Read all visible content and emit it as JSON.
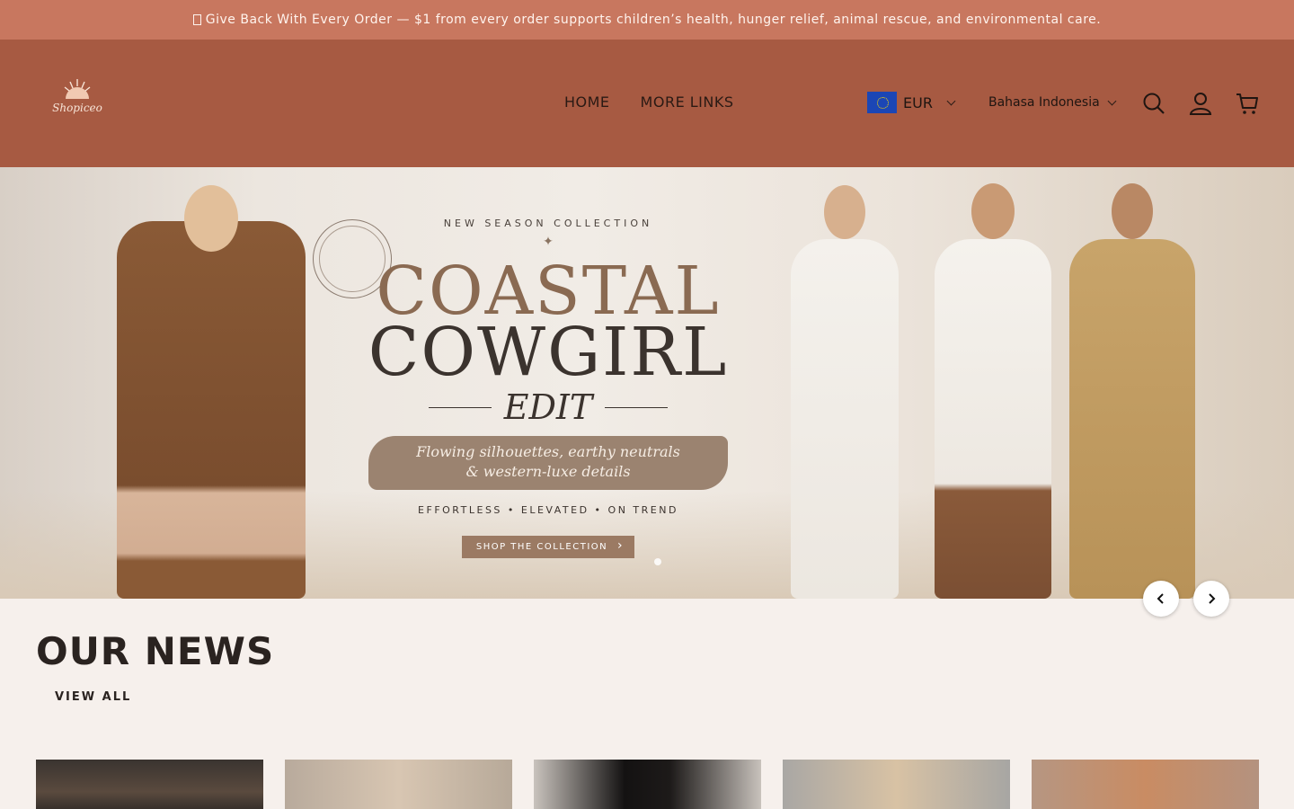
{
  "announcement": {
    "text": "Give Back With Every Order — $1 from every order supports children’s health, hunger relief, animal rescue, and environmental care."
  },
  "header": {
    "logo_text": "Shopiceo",
    "nav": [
      {
        "label": "HOME"
      },
      {
        "label": "MORE LINKS"
      }
    ],
    "currency": {
      "code": "EUR",
      "icon": "eu-flag-icon"
    },
    "language": "Bahasa Indonesia",
    "icons": [
      "search-icon",
      "account-icon",
      "cart-icon"
    ]
  },
  "hero": {
    "badge_text": "NEW SEASON COLLECTION",
    "kicker": "NEW SEASON COLLECTION",
    "title_line1": "COASTAL",
    "title_line2": "COWGIRL",
    "title_line3": "EDIT",
    "tagline_line1": "Flowing silhouettes, earthy neutrals",
    "tagline_line2": "& western-luxe details",
    "tags": "EFFORTLESS  •  ELEVATED  •  ON TREND",
    "cta": "SHOP THE COLLECTION"
  },
  "slider": {
    "prev_icon": "chevron-left-icon",
    "next_icon": "chevron-right-icon"
  },
  "news": {
    "title": "OUR NEWS",
    "view_all": "VIEW ALL",
    "card_count": 5
  },
  "colors": {
    "announcement_bg": "#c8775f",
    "header_bg": "#a75a42",
    "page_bg": "#f6f0ec"
  }
}
